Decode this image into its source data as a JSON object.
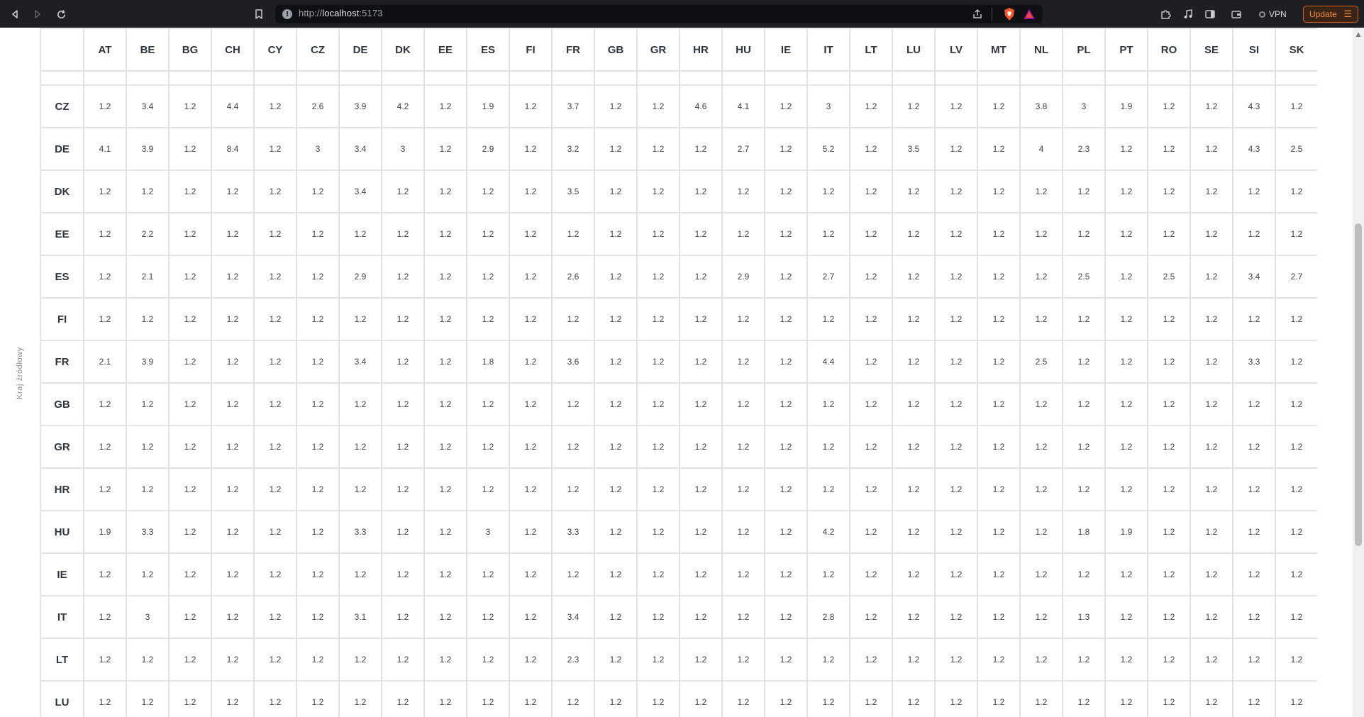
{
  "browser": {
    "url_scheme": "http://",
    "url_host": "localhost",
    "url_port": ":5173",
    "vpn_label": "VPN",
    "update_label": "Update",
    "icons": {
      "back": "back-arrow-icon",
      "forward": "forward-arrow-icon",
      "reload": "reload-icon",
      "bookmark": "bookmark-icon",
      "site_info": "site-info-icon",
      "share": "share-icon",
      "brave": "brave-shield-icon",
      "rewards": "brave-rewards-icon",
      "extensions": "extensions-icon",
      "media": "media-icon",
      "sidebar": "sidebar-icon",
      "wallet": "wallet-icon",
      "menu": "menu-icon"
    },
    "colors": {
      "update_accent": "#f08a3e",
      "chrome_bg": "#1e1f22"
    }
  },
  "page": {
    "axis_label": "Kraj źródłowy"
  },
  "scrollbar": {
    "position_fraction": 0.3,
    "visible_fraction": 0.48
  },
  "table": {
    "columns": [
      "AT",
      "BE",
      "BG",
      "CH",
      "CY",
      "CZ",
      "DE",
      "DK",
      "EE",
      "ES",
      "FI",
      "FR",
      "GB",
      "GR",
      "HR",
      "HU",
      "IE",
      "IT",
      "LT",
      "LU",
      "LV",
      "MT",
      "NL",
      "PL",
      "PT",
      "RO",
      "SE",
      "SI",
      "SK"
    ],
    "rows": [
      {
        "label": "CZ",
        "values": [
          "1.2",
          "3.4",
          "1.2",
          "4.4",
          "1.2",
          "2.6",
          "3.9",
          "4.2",
          "1.2",
          "1.9",
          "1.2",
          "3.7",
          "1.2",
          "1.2",
          "4.6",
          "4.1",
          "1.2",
          "3",
          "1.2",
          "1.2",
          "1.2",
          "1.2",
          "3.8",
          "3",
          "1.9",
          "1.2",
          "1.2",
          "4.3",
          "1.2"
        ]
      },
      {
        "label": "DE",
        "values": [
          "4.1",
          "3.9",
          "1.2",
          "8.4",
          "1.2",
          "3",
          "3.4",
          "3",
          "1.2",
          "2.9",
          "1.2",
          "3.2",
          "1.2",
          "1.2",
          "1.2",
          "2.7",
          "1.2",
          "5.2",
          "1.2",
          "3.5",
          "1.2",
          "1.2",
          "4",
          "2.3",
          "1.2",
          "1.2",
          "1.2",
          "4.3",
          "2.5"
        ]
      },
      {
        "label": "DK",
        "values": [
          "1.2",
          "1.2",
          "1.2",
          "1.2",
          "1.2",
          "1.2",
          "3.4",
          "1.2",
          "1.2",
          "1.2",
          "1.2",
          "3.5",
          "1.2",
          "1.2",
          "1.2",
          "1.2",
          "1.2",
          "1.2",
          "1.2",
          "1.2",
          "1.2",
          "1.2",
          "1.2",
          "1.2",
          "1.2",
          "1.2",
          "1.2",
          "1.2",
          "1.2"
        ]
      },
      {
        "label": "EE",
        "values": [
          "1.2",
          "2.2",
          "1.2",
          "1.2",
          "1.2",
          "1.2",
          "1.2",
          "1.2",
          "1.2",
          "1.2",
          "1.2",
          "1.2",
          "1.2",
          "1.2",
          "1.2",
          "1.2",
          "1.2",
          "1.2",
          "1.2",
          "1.2",
          "1.2",
          "1.2",
          "1.2",
          "1.2",
          "1.2",
          "1.2",
          "1.2",
          "1.2",
          "1.2"
        ]
      },
      {
        "label": "ES",
        "values": [
          "1.2",
          "2.1",
          "1.2",
          "1.2",
          "1.2",
          "1.2",
          "2.9",
          "1.2",
          "1.2",
          "1.2",
          "1.2",
          "2.6",
          "1.2",
          "1.2",
          "1.2",
          "2.9",
          "1.2",
          "2.7",
          "1.2",
          "1.2",
          "1.2",
          "1.2",
          "1.2",
          "2.5",
          "1.2",
          "2.5",
          "1.2",
          "3.4",
          "2.7"
        ]
      },
      {
        "label": "FI",
        "values": [
          "1.2",
          "1.2",
          "1.2",
          "1.2",
          "1.2",
          "1.2",
          "1.2",
          "1.2",
          "1.2",
          "1.2",
          "1.2",
          "1.2",
          "1.2",
          "1.2",
          "1.2",
          "1.2",
          "1.2",
          "1.2",
          "1.2",
          "1.2",
          "1.2",
          "1.2",
          "1.2",
          "1.2",
          "1.2",
          "1.2",
          "1.2",
          "1.2",
          "1.2"
        ]
      },
      {
        "label": "FR",
        "values": [
          "2.1",
          "3.9",
          "1.2",
          "1.2",
          "1.2",
          "1.2",
          "3.4",
          "1.2",
          "1.2",
          "1.8",
          "1.2",
          "3.6",
          "1.2",
          "1.2",
          "1.2",
          "1.2",
          "1.2",
          "4.4",
          "1.2",
          "1.2",
          "1.2",
          "1.2",
          "2.5",
          "1.2",
          "1.2",
          "1.2",
          "1.2",
          "3.3",
          "1.2"
        ]
      },
      {
        "label": "GB",
        "values": [
          "1.2",
          "1.2",
          "1.2",
          "1.2",
          "1.2",
          "1.2",
          "1.2",
          "1.2",
          "1.2",
          "1.2",
          "1.2",
          "1.2",
          "1.2",
          "1.2",
          "1.2",
          "1.2",
          "1.2",
          "1.2",
          "1.2",
          "1.2",
          "1.2",
          "1.2",
          "1.2",
          "1.2",
          "1.2",
          "1.2",
          "1.2",
          "1.2",
          "1.2"
        ]
      },
      {
        "label": "GR",
        "values": [
          "1.2",
          "1.2",
          "1.2",
          "1.2",
          "1.2",
          "1.2",
          "1.2",
          "1.2",
          "1.2",
          "1.2",
          "1.2",
          "1.2",
          "1.2",
          "1.2",
          "1.2",
          "1.2",
          "1.2",
          "1.2",
          "1.2",
          "1.2",
          "1.2",
          "1.2",
          "1.2",
          "1.2",
          "1.2",
          "1.2",
          "1.2",
          "1.2",
          "1.2"
        ]
      },
      {
        "label": "HR",
        "values": [
          "1.2",
          "1.2",
          "1.2",
          "1.2",
          "1.2",
          "1.2",
          "1.2",
          "1.2",
          "1.2",
          "1.2",
          "1.2",
          "1.2",
          "1.2",
          "1.2",
          "1.2",
          "1.2",
          "1.2",
          "1.2",
          "1.2",
          "1.2",
          "1.2",
          "1.2",
          "1.2",
          "1.2",
          "1.2",
          "1.2",
          "1.2",
          "1.2",
          "1.2"
        ]
      },
      {
        "label": "HU",
        "values": [
          "1.9",
          "3.3",
          "1.2",
          "1.2",
          "1.2",
          "1.2",
          "3.3",
          "1.2",
          "1.2",
          "3",
          "1.2",
          "3.3",
          "1.2",
          "1.2",
          "1.2",
          "1.2",
          "1.2",
          "4.2",
          "1.2",
          "1.2",
          "1.2",
          "1.2",
          "1.2",
          "1.8",
          "1.9",
          "1.2",
          "1.2",
          "1.2",
          "1.2"
        ]
      },
      {
        "label": "IE",
        "values": [
          "1.2",
          "1.2",
          "1.2",
          "1.2",
          "1.2",
          "1.2",
          "1.2",
          "1.2",
          "1.2",
          "1.2",
          "1.2",
          "1.2",
          "1.2",
          "1.2",
          "1.2",
          "1.2",
          "1.2",
          "1.2",
          "1.2",
          "1.2",
          "1.2",
          "1.2",
          "1.2",
          "1.2",
          "1.2",
          "1.2",
          "1.2",
          "1.2",
          "1.2"
        ]
      },
      {
        "label": "IT",
        "values": [
          "1.2",
          "3",
          "1.2",
          "1.2",
          "1.2",
          "1.2",
          "3.1",
          "1.2",
          "1.2",
          "1.2",
          "1.2",
          "3.4",
          "1.2",
          "1.2",
          "1.2",
          "1.2",
          "1.2",
          "2.8",
          "1.2",
          "1.2",
          "1.2",
          "1.2",
          "1.2",
          "1.3",
          "1.2",
          "1.2",
          "1.2",
          "1.2",
          "1.2"
        ]
      },
      {
        "label": "LT",
        "values": [
          "1.2",
          "1.2",
          "1.2",
          "1.2",
          "1.2",
          "1.2",
          "1.2",
          "1.2",
          "1.2",
          "1.2",
          "1.2",
          "2.3",
          "1.2",
          "1.2",
          "1.2",
          "1.2",
          "1.2",
          "1.2",
          "1.2",
          "1.2",
          "1.2",
          "1.2",
          "1.2",
          "1.2",
          "1.2",
          "1.2",
          "1.2",
          "1.2",
          "1.2"
        ]
      },
      {
        "label": "LU",
        "values": [
          "1.2",
          "1.2",
          "1.2",
          "1.2",
          "1.2",
          "1.2",
          "1.2",
          "1.2",
          "1.2",
          "1.2",
          "1.2",
          "1.2",
          "1.2",
          "1.2",
          "1.2",
          "1.2",
          "1.2",
          "1.2",
          "1.2",
          "1.2",
          "1.2",
          "1.2",
          "1.2",
          "1.2",
          "1.2",
          "1.2",
          "1.2",
          "1.2",
          "1.2"
        ]
      }
    ]
  }
}
